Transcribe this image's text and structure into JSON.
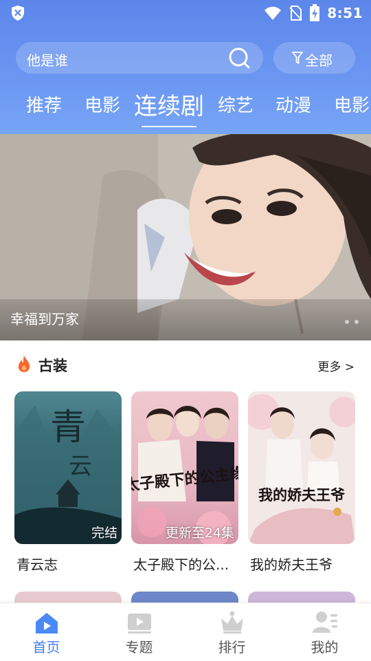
{
  "status_bar": {
    "time": "8:51"
  },
  "search": {
    "placeholder": "他是谁"
  },
  "filter": {
    "label": "全部"
  },
  "tabs": [
    {
      "label": "推荐"
    },
    {
      "label": "电影"
    },
    {
      "label": "连续剧",
      "active": true
    },
    {
      "label": "综艺"
    },
    {
      "label": "动漫"
    },
    {
      "label": "电影"
    }
  ],
  "banner": {
    "caption": "幸福到万家",
    "slide_count": 2
  },
  "section": {
    "title": "古装",
    "more": "更多 >"
  },
  "cards": [
    {
      "title": "青云志",
      "badge": "完结"
    },
    {
      "title": "太子殿下的公...",
      "badge": "更新至24集",
      "poster_text": "太子殿下的公主缘"
    },
    {
      "title": "我的娇夫王爷",
      "badge": "",
      "poster_text": "我的娇夫王爷"
    }
  ],
  "bottom_nav": [
    {
      "label": "首页",
      "icon": "home-icon",
      "active": true
    },
    {
      "label": "专题",
      "icon": "play-icon"
    },
    {
      "label": "排行",
      "icon": "crown-icon"
    },
    {
      "label": "我的",
      "icon": "user-icon"
    }
  ],
  "colors": {
    "header": "#6b97f2",
    "accent": "#3f7ef0",
    "fire": "#f5682c"
  }
}
